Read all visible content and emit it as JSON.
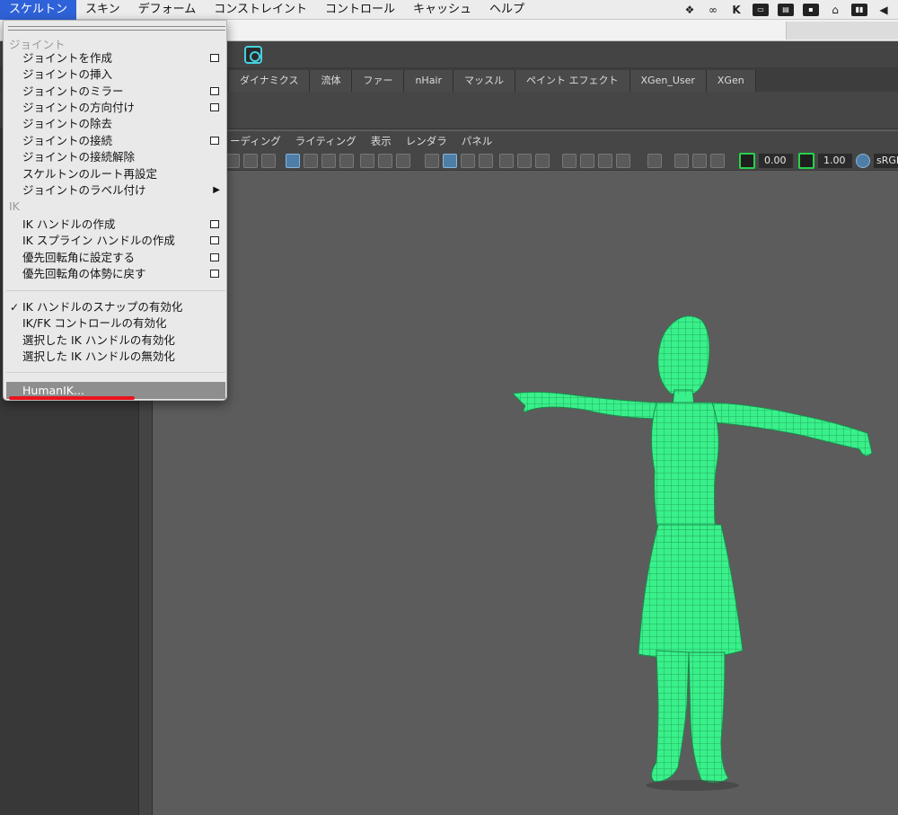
{
  "menubar": {
    "items": [
      "スケルトン",
      "スキン",
      "デフォーム",
      "コンストレイント",
      "コントロール",
      "キャッシュ",
      "ヘルプ"
    ],
    "tray_icons": [
      "dropbox-icon",
      "creative-cloud-icon",
      "k-icon",
      "monitor-icon",
      "display-icon",
      "app-icon",
      "cloud-home-icon",
      "battery-icon",
      "volume-icon"
    ]
  },
  "shelf_tabs": [
    "ダイナミクス",
    "流体",
    "ファー",
    "nHair",
    "マッスル",
    "ペイント エフェクト",
    "XGen_User",
    "XGen"
  ],
  "viewport": {
    "menu": [
      "ーディング",
      "ライティング",
      "表示",
      "レンダラ",
      "パネル"
    ],
    "exposure": "0.00",
    "gamma": "1.00",
    "color_space": "sRGB"
  },
  "dropdown": {
    "section_joint": "ジョイント",
    "joint_items": [
      "ジョイントを作成",
      "ジョイントの挿入",
      "ジョイントのミラー",
      "ジョイントの方向付け",
      "ジョイントの除去",
      "ジョイントの接続",
      "ジョイントの接続解除",
      "スケルトンのルート再設定",
      "ジョイントのラベル付け"
    ],
    "section_ik": "IK",
    "ik_items": [
      "IK ハンドルの作成",
      "IK スプライン ハンドルの作成",
      "優先回転角に設定する",
      "優先回転角の体勢に戻す"
    ],
    "toggle_items": [
      "IK ハンドルのスナップの有効化",
      "IK/FK コントロールの有効化",
      "選択した IK ハンドルの有効化",
      "選択した IK ハンドルの無効化"
    ],
    "humanik": "HumanIK..."
  },
  "colors": {
    "accent_blue": "#2f62d8",
    "wireframe": "#39f08a",
    "underline": "#e8141c"
  }
}
